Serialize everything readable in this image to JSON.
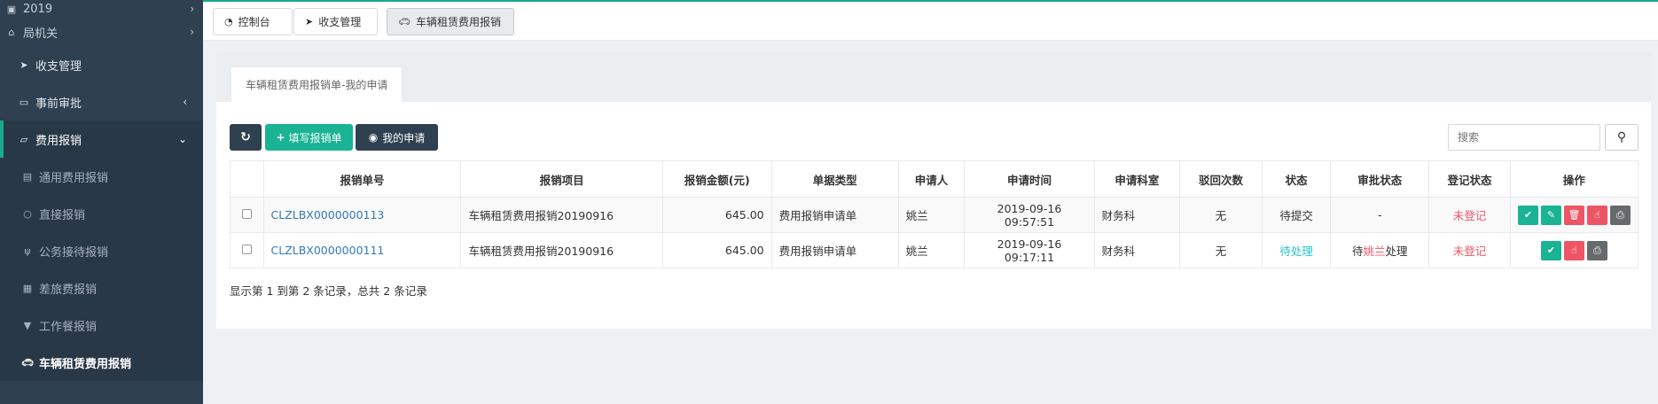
{
  "sidebar": {
    "year": "2019",
    "org": "局机关",
    "items": [
      {
        "label": "收支管理",
        "icon": "paper-plane-icon"
      },
      {
        "label": "事前审批",
        "icon": "folder-icon"
      },
      {
        "label": "费用报销",
        "icon": "folder-open-icon"
      }
    ],
    "sub_items": [
      {
        "label": "通用费用报销",
        "icon": "id-card-icon"
      },
      {
        "label": "直接报销",
        "icon": "circle-icon"
      },
      {
        "label": "公务接待报销",
        "icon": "cutlery-icon"
      },
      {
        "label": "差旅费报销",
        "icon": "image-icon"
      },
      {
        "label": "工作餐报销",
        "icon": "filter-icon"
      },
      {
        "label": "车辆租赁费用报销",
        "icon": "car-icon"
      }
    ]
  },
  "top_tabs": [
    {
      "label": "控制台",
      "icon": "dashboard-icon"
    },
    {
      "label": "收支管理",
      "icon": "paper-plane-icon"
    },
    {
      "label": "车辆租赁费用报销",
      "icon": "car-icon"
    }
  ],
  "panel": {
    "tab_title": "车辆租赁费用报销单-我的申请"
  },
  "toolbar": {
    "refresh_label": "",
    "fill_label": "填写报销单",
    "mine_label": "我的申请"
  },
  "search": {
    "placeholder": "搜索"
  },
  "table": {
    "headers": [
      "报销单号",
      "报销项目",
      "报销金额(元)",
      "单据类型",
      "申请人",
      "申请时间",
      "申请科室",
      "驳回次数",
      "状态",
      "审批状态",
      "登记状态",
      "操作"
    ],
    "rows": [
      {
        "no": "CLZLBX0000000113",
        "project": "车辆租赁费用报销20190916",
        "amount": "645.00",
        "doc_type": "费用报销申请单",
        "applicant": "姚兰",
        "time": "2019-09-16 09:57:51",
        "dept": "财务科",
        "rejects": "无",
        "status": "待提交",
        "approval": "-",
        "approval_pre": "",
        "approval_name": "",
        "approval_post": "",
        "register": "未登记"
      },
      {
        "no": "CLZLBX0000000111",
        "project": "车辆租赁费用报销20190916",
        "amount": "645.00",
        "doc_type": "费用报销申请单",
        "applicant": "姚兰",
        "time": "2019-09-16 09:17:11",
        "dept": "财务科",
        "rejects": "无",
        "status": "待处理",
        "approval": "",
        "approval_pre": "待",
        "approval_name": "姚兰",
        "approval_post": "处理",
        "register": "未登记"
      }
    ]
  },
  "summary": "显示第 1 到第 2 条记录，总共 2 条记录",
  "colors": {
    "sidebar_bg": "#2f4050",
    "accent": "#1ab394",
    "danger": "#ed5565",
    "info": "#23c6c8",
    "link": "#337ab7"
  }
}
